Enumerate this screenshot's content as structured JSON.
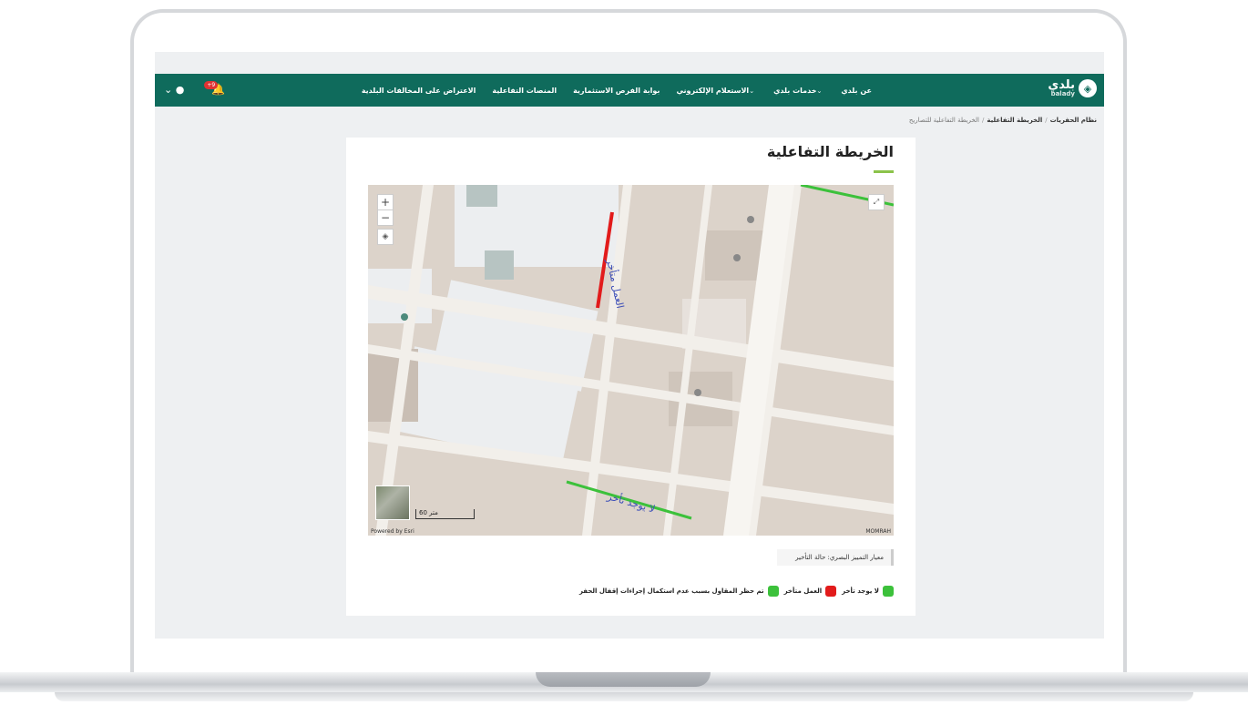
{
  "nav": {
    "logo_text": "بلدي",
    "logo_sub": "balady",
    "menu": [
      {
        "label": "عن بلدي",
        "dropdown": false
      },
      {
        "label": "خدمات بلدي",
        "dropdown": true
      },
      {
        "label": "الاستعلام الإلكتروني",
        "dropdown": true
      },
      {
        "label": "بوابة الفرص الاستثمارية",
        "dropdown": false
      },
      {
        "label": "المنصات التفاعلية",
        "dropdown": false
      },
      {
        "label": "الاعتراض على المخالفات البلدية",
        "dropdown": false
      }
    ],
    "notification_count": "+9"
  },
  "breadcrumb": {
    "item1": "نظام الحفريات",
    "item2": "الخريطة التفاعلية",
    "current": "الخريطة التفاعلية للتصاريح"
  },
  "page": {
    "title": "الخريطة التفاعلية"
  },
  "map": {
    "scale_label": "60 متر",
    "powered_by": "Powered by Esri",
    "attribution": "MOMRAH",
    "segment_labels": [
      "العمل متأخر",
      "لا يوجد تأخر"
    ]
  },
  "legend": {
    "criterion": "معيار التمييز البصري: حالة التأخير",
    "items": [
      {
        "label": "لا يوجد تأخر",
        "color": "#3cc13b"
      },
      {
        "label": "العمل متأخر",
        "color": "#e21b1b"
      },
      {
        "label": "تم حظر المقاول بسبب عدم استكمال إجراءات إقفال الحفر",
        "color": "#3cc13b"
      }
    ]
  },
  "colors": {
    "nav": "#0f6b5c",
    "accent": "#8bc34a",
    "delay": "#e21b1b",
    "ok": "#3cc13b"
  }
}
